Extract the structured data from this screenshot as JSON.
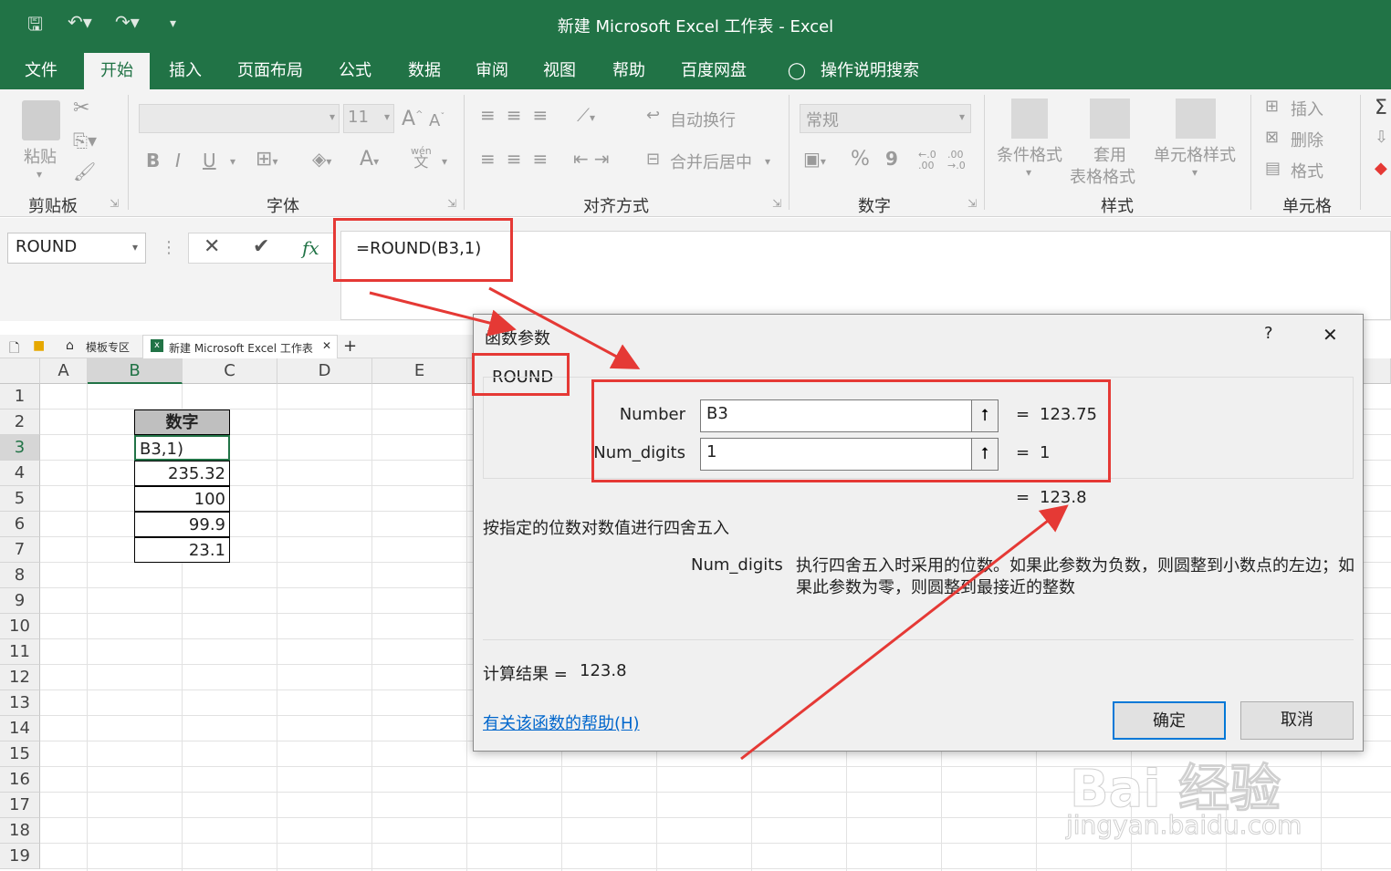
{
  "title_bar": {
    "title": "新建 Microsoft Excel 工作表  -  Excel"
  },
  "tabs": [
    "文件",
    "开始",
    "插入",
    "页面布局",
    "公式",
    "数据",
    "审阅",
    "视图",
    "帮助",
    "百度网盘",
    "操作说明搜索"
  ],
  "active_tab": "开始",
  "ribbon": {
    "clipboard": {
      "paste": "粘贴",
      "label": "剪贴板"
    },
    "font": {
      "size": "11",
      "label": "字体",
      "bold": "B",
      "italic": "I",
      "underline": "U",
      "pinyin_top": "wén",
      "pinyin_bottom": "文"
    },
    "alignment": {
      "wrap": "自动换行",
      "merge": "合并后居中",
      "label": "对齐方式"
    },
    "number": {
      "format": "常规",
      "label": "数字",
      "percent": "%",
      "comma": "9",
      "inc_decimal": "←.0\n.00",
      "dec_decimal": ".00\n→.0"
    },
    "styles": {
      "conditional": "条件格式",
      "table_line1": "套用",
      "table_line2": "表格格式",
      "cell_styles": "单元格样式",
      "label": "样式"
    },
    "cells": {
      "insert": "插入",
      "delete": "删除",
      "format": "格式",
      "label": "单元格"
    }
  },
  "formula_bar": {
    "name_box": "ROUND",
    "fx": "fx",
    "formula": "=ROUND(B3,1)"
  },
  "sheet_tabs": {
    "template_tab": "模板专区",
    "file_tab": "新建 Microsoft Excel 工作表"
  },
  "grid": {
    "columns": [
      "A",
      "B",
      "C",
      "D",
      "E"
    ],
    "rows": [
      "1",
      "2",
      "3",
      "4",
      "5",
      "6",
      "7",
      "8",
      "9",
      "10",
      "11",
      "12",
      "13",
      "14",
      "15",
      "16",
      "17",
      "18",
      "19"
    ],
    "header_cell": "数字",
    "b_values": [
      "B3,1)",
      "235.32",
      "100",
      "99.9",
      "23.1"
    ]
  },
  "dialog": {
    "title": "函数参数",
    "help_glyph": "?",
    "close_glyph": "✕",
    "function_name": "ROUND",
    "args": [
      {
        "name": "Number",
        "value": "B3",
        "result": "123.75"
      },
      {
        "name": "Num_digits",
        "value": "1",
        "result": "1"
      }
    ],
    "eq": "=",
    "formula_result": "123.8",
    "description": "按指定的位数对数值进行四舍五入",
    "arg_help_name": "Num_digits",
    "arg_help_text": "执行四舍五入时采用的位数。如果此参数为负数，则圆整到小数点的左边；如果此参数为零，则圆整到最接近的整数",
    "calc_label": "计算结果 =",
    "calc_value": "123.8",
    "help_link": "有关该函数的帮助(H)",
    "ok": "确定",
    "cancel": "取消"
  },
  "watermark": {
    "brand": "Bai 经验",
    "url": "jingyan.baidu.com"
  },
  "colors": {
    "excel_green": "#217346",
    "annotation_red": "#e53935",
    "link_blue": "#0066cc"
  }
}
